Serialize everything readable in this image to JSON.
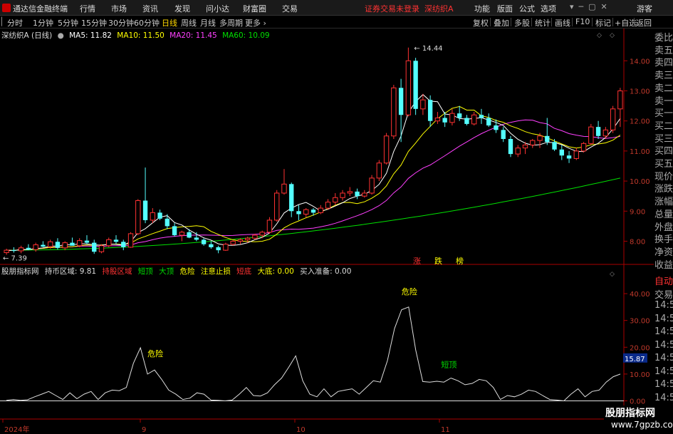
{
  "app": {
    "title": "通达信金融终端",
    "login_status": "证券交易未登录",
    "stock_name": "深纺织A"
  },
  "menu": [
    "行情",
    "市场",
    "资讯",
    "发现",
    "问小达",
    "财富圈",
    "交易"
  ],
  "menu_right": [
    "功能",
    "版面",
    "公式",
    "选项",
    "游客"
  ],
  "periods": [
    {
      "label": "分时"
    },
    {
      "label": "1分钟"
    },
    {
      "label": "5分钟"
    },
    {
      "label": "15分钟"
    },
    {
      "label": "30分钟"
    },
    {
      "label": "60分钟"
    },
    {
      "label": "日线",
      "active": true
    },
    {
      "label": "周线"
    },
    {
      "label": "月线"
    },
    {
      "label": "多周期"
    },
    {
      "label": "更多"
    }
  ],
  "toolbar_right": [
    "复权",
    "叠加",
    "多股",
    "统计",
    "画线",
    "F10",
    "标记",
    "+自选",
    "返回"
  ],
  "legend": {
    "name": "深纺织A (日线)",
    "ma5": "MA5: 11.82",
    "ma10": "MA10: 11.50",
    "ma20": "MA20: 11.45",
    "ma60": "MA60: 10.09"
  },
  "colors": {
    "up": "#ff3232",
    "down": "#54ffff",
    "ma5": "#ffffff",
    "ma10": "#ffff00",
    "ma20": "#ff40ff",
    "ma60": "#00e000"
  },
  "chart_data": [
    {
      "type": "candlestick",
      "title": "深纺织A (日线)",
      "ylim": [
        7.3,
        14.6
      ],
      "y_ticks": [
        "14.00",
        "13.00",
        "12.00",
        "11.00",
        "10.00",
        "9.00",
        "8.00"
      ],
      "x_ticks": [
        "2024年",
        "9",
        "10",
        "11"
      ],
      "annotations": [
        "14.44",
        "7.39"
      ],
      "signals": [
        "涨",
        "跌",
        "榜"
      ],
      "ohlc": [
        [
          7.62,
          7.75,
          7.55,
          7.7
        ],
        [
          7.7,
          7.8,
          7.62,
          7.68
        ],
        [
          7.68,
          7.85,
          7.6,
          7.78
        ],
        [
          7.78,
          7.9,
          7.7,
          7.72
        ],
        [
          7.72,
          7.95,
          7.65,
          7.88
        ],
        [
          7.88,
          8.0,
          7.8,
          7.82
        ],
        [
          7.82,
          8.05,
          7.75,
          7.98
        ],
        [
          7.98,
          8.1,
          7.72,
          7.78
        ],
        [
          7.78,
          8.0,
          7.7,
          7.95
        ],
        [
          7.95,
          8.12,
          7.88,
          7.85
        ],
        [
          7.85,
          8.1,
          7.8,
          8.02
        ],
        [
          8.02,
          8.2,
          7.9,
          7.95
        ],
        [
          7.95,
          8.05,
          7.58,
          7.65
        ],
        [
          7.65,
          7.9,
          7.6,
          7.85
        ],
        [
          7.85,
          8.12,
          7.8,
          8.05
        ],
        [
          8.05,
          8.2,
          7.92,
          7.98
        ],
        [
          7.98,
          8.05,
          7.7,
          7.8
        ],
        [
          7.8,
          8.3,
          7.78,
          8.25
        ],
        [
          8.25,
          9.4,
          8.2,
          9.35
        ],
        [
          9.35,
          10.45,
          8.6,
          8.7
        ],
        [
          8.7,
          9.1,
          8.6,
          8.95
        ],
        [
          8.95,
          9.05,
          8.7,
          8.75
        ],
        [
          8.75,
          8.9,
          8.4,
          8.5
        ],
        [
          8.5,
          8.6,
          8.15,
          8.2
        ],
        [
          8.2,
          8.35,
          8.0,
          8.3
        ],
        [
          8.3,
          8.4,
          8.1,
          8.12
        ],
        [
          8.12,
          8.3,
          8.0,
          8.05
        ],
        [
          8.05,
          8.1,
          7.85,
          7.9
        ],
        [
          7.9,
          8.0,
          7.75,
          7.8
        ],
        [
          7.8,
          7.85,
          7.6,
          7.7
        ],
        [
          7.7,
          7.95,
          7.68,
          7.9
        ],
        [
          7.9,
          8.05,
          7.85,
          8.0
        ],
        [
          8.0,
          8.1,
          7.9,
          8.05
        ],
        [
          8.05,
          8.15,
          7.95,
          8.1
        ],
        [
          8.1,
          8.25,
          8.05,
          8.2
        ],
        [
          8.2,
          8.35,
          8.1,
          8.3
        ],
        [
          8.3,
          8.8,
          8.25,
          8.7
        ],
        [
          8.7,
          9.7,
          8.65,
          9.6
        ],
        [
          9.6,
          10.4,
          9.55,
          9.9
        ],
        [
          9.9,
          9.95,
          8.8,
          9.0
        ],
        [
          9.0,
          9.2,
          8.7,
          8.9
        ],
        [
          8.9,
          9.1,
          8.8,
          9.05
        ],
        [
          9.05,
          9.1,
          8.85,
          8.95
        ],
        [
          8.95,
          9.2,
          8.9,
          9.1
        ],
        [
          9.1,
          9.4,
          9.05,
          9.3
        ],
        [
          9.3,
          9.6,
          9.2,
          9.45
        ],
        [
          9.45,
          9.7,
          9.35,
          9.6
        ],
        [
          9.6,
          9.8,
          9.5,
          9.65
        ],
        [
          9.65,
          9.75,
          9.4,
          9.5
        ],
        [
          9.5,
          9.7,
          9.45,
          9.6
        ],
        [
          9.6,
          10.2,
          9.55,
          10.1
        ],
        [
          10.1,
          10.7,
          10.0,
          10.6
        ],
        [
          10.6,
          11.6,
          10.55,
          11.5
        ],
        [
          11.5,
          13.2,
          11.4,
          13.1
        ],
        [
          13.1,
          13.4,
          11.3,
          12.2
        ],
        [
          12.2,
          14.44,
          12.15,
          14.0
        ],
        [
          14.0,
          14.1,
          12.2,
          12.4
        ],
        [
          12.4,
          12.9,
          12.2,
          12.7
        ],
        [
          12.7,
          12.85,
          11.8,
          12.0
        ],
        [
          12.0,
          12.3,
          11.9,
          12.1
        ],
        [
          12.1,
          12.3,
          11.8,
          11.95
        ],
        [
          11.95,
          12.4,
          11.85,
          12.25
        ],
        [
          12.25,
          12.5,
          12.0,
          12.1
        ],
        [
          12.1,
          12.2,
          11.85,
          11.9
        ],
        [
          11.9,
          12.3,
          11.85,
          12.2
        ],
        [
          12.2,
          12.4,
          11.9,
          12.1
        ],
        [
          12.1,
          12.25,
          11.8,
          11.85
        ],
        [
          11.85,
          12.05,
          11.6,
          11.7
        ],
        [
          11.7,
          11.8,
          11.3,
          11.4
        ],
        [
          11.4,
          11.5,
          10.8,
          10.9
        ],
        [
          10.9,
          11.2,
          10.8,
          11.1
        ],
        [
          11.1,
          11.3,
          10.9,
          11.2
        ],
        [
          11.2,
          11.4,
          11.1,
          11.35
        ],
        [
          11.35,
          11.6,
          11.1,
          11.5
        ],
        [
          11.5,
          12.1,
          11.2,
          11.3
        ],
        [
          11.3,
          11.4,
          11.0,
          11.05
        ],
        [
          11.05,
          11.2,
          10.7,
          10.85
        ],
        [
          10.85,
          11.0,
          10.6,
          10.75
        ],
        [
          10.75,
          11.1,
          10.7,
          11.0
        ],
        [
          11.0,
          11.3,
          10.95,
          11.25
        ],
        [
          11.25,
          11.9,
          11.2,
          11.8
        ],
        [
          11.8,
          12.0,
          11.4,
          11.5
        ],
        [
          11.5,
          11.8,
          11.4,
          11.7
        ],
        [
          11.7,
          12.5,
          11.6,
          12.4
        ],
        [
          12.4,
          13.1,
          11.8,
          13.0
        ]
      ]
    },
    {
      "type": "line",
      "title": "股朋指标网",
      "ylim": [
        -2,
        44
      ],
      "y_ticks": [
        "40.00",
        "30.00",
        "20.00",
        "10.00",
        "0.00"
      ],
      "current_value": "15.87",
      "annotations": [
        {
          "text": "危险",
          "index": 20,
          "value": 19.8
        },
        {
          "text": "危险",
          "index": 56,
          "value": 35
        },
        {
          "text": "短顶",
          "index": 61,
          "value": 7.2
        }
      ],
      "values": [
        0.2,
        0.5,
        0.2,
        0.4,
        1.5,
        2.5,
        3.5,
        2.0,
        0.5,
        3.0,
        0.8,
        2.5,
        3.5,
        0.5,
        3.0,
        4.0,
        3.8,
        5.0,
        14.0,
        19.8,
        10.0,
        11.5,
        8.0,
        4.0,
        2.5,
        0.5,
        1.0,
        3.0,
        2.5,
        0.3,
        0.2,
        0.0,
        0.3,
        2.5,
        5.0,
        2.0,
        1.8,
        3.0,
        6.0,
        8.5,
        12.5,
        16.8,
        7.5,
        2.5,
        1.5,
        4.5,
        1.5,
        3.5,
        4.0,
        4.5,
        2.5,
        5.0,
        7.5,
        7.0,
        15.0,
        27.0,
        34.0,
        35.0,
        19.0,
        7.2,
        7.0,
        7.3,
        7.0,
        8.5,
        7.5,
        6.0,
        6.5,
        8.0,
        7.5,
        5.0,
        0.5,
        2.0,
        1.5,
        2.5,
        4.0,
        3.5,
        2.0,
        0.5,
        0.3,
        0.0,
        2.5,
        4.5,
        1.5,
        3.5,
        4.0,
        7.0,
        9.0,
        10.0
      ]
    }
  ],
  "indicator_legend": {
    "name": "股朋指标网",
    "hold": "持币区域: 9.81",
    "stock_area": "持股区域",
    "short_top": "短顶",
    "big_top": "大顶",
    "danger": "危险",
    "stop_loss": "注意止损",
    "short_bottom": "短底",
    "big_bottom": "大底: 0.00",
    "buy_prep": "买入准备: 0.00"
  },
  "right_panel": {
    "top": [
      "委比",
      "卖五",
      "卖四",
      "卖三",
      "卖二",
      "卖一",
      "买一",
      "买二",
      "买三",
      "买四",
      "买五",
      "现价",
      "涨跌",
      "涨幅",
      "总量",
      "外盘",
      "换手",
      "净资",
      "收益"
    ],
    "bottom": [
      "自动",
      "交易",
      "14:5",
      "14:5",
      "14:5",
      "14:5",
      "14:5",
      "14:5",
      "14:5",
      "14:5"
    ]
  },
  "watermark": {
    "text": "股朋指标网",
    "url": "www.7gpzb.com"
  }
}
